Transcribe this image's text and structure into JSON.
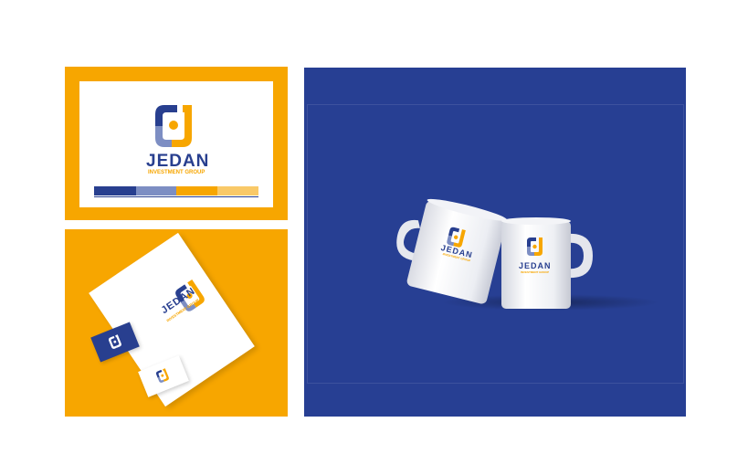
{
  "brand": {
    "name": "JEDAN",
    "tagline": "INVESTMENT GROUP"
  },
  "palette": {
    "navy": "#283f8f",
    "periwinkle": "#7d8ec3",
    "orange": "#f7a600",
    "light_orange": "#f9c968",
    "mug_background": "#273f93"
  },
  "swatches": [
    "navy",
    "periwinkle",
    "orange",
    "light_orange"
  ],
  "icons": {
    "logo_mark": "square-bracket-with-dot-icon"
  }
}
